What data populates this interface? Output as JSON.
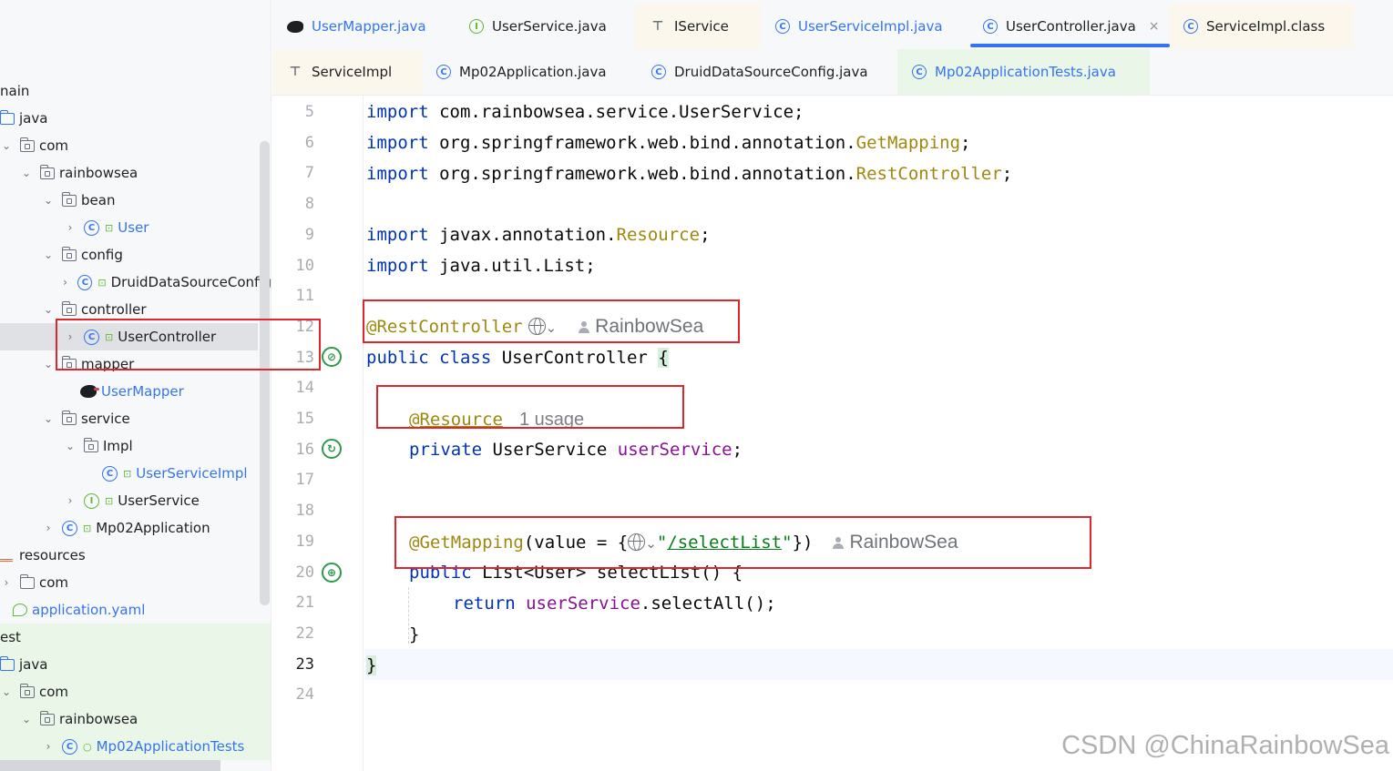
{
  "tree": {
    "items": [
      {
        "label": "nain",
        "icon": "none",
        "chevron": "",
        "blue": false
      },
      {
        "label": "java",
        "icon": "source-folder-icon",
        "chevron": "",
        "blue": false
      },
      {
        "label": "com",
        "icon": "package-folder-icon",
        "chevron": "⌄",
        "blue": false
      },
      {
        "label": "rainbowsea",
        "icon": "package-folder-icon",
        "chevron": "⌄",
        "blue": false
      },
      {
        "label": "bean",
        "icon": "package-folder-icon",
        "chevron": "⌄",
        "blue": false
      },
      {
        "label": "User",
        "icon": "class-icon",
        "chevron": "›",
        "blue": true
      },
      {
        "label": "config",
        "icon": "package-folder-icon",
        "chevron": "⌄",
        "blue": false
      },
      {
        "label": "DruidDataSourceConfig",
        "icon": "class-icon",
        "chevron": "›",
        "blue": false
      },
      {
        "label": "controller",
        "icon": "package-folder-icon",
        "chevron": "⌄",
        "blue": false
      },
      {
        "label": "UserController",
        "icon": "class-icon",
        "chevron": "›",
        "blue": false
      },
      {
        "label": "mapper",
        "icon": "package-folder-icon",
        "chevron": "⌄",
        "blue": false
      },
      {
        "label": "UserMapper",
        "icon": "mybatis-bird-icon",
        "chevron": "",
        "blue": true
      },
      {
        "label": "service",
        "icon": "package-folder-icon",
        "chevron": "⌄",
        "blue": false
      },
      {
        "label": "Impl",
        "icon": "package-folder-icon",
        "chevron": "⌄",
        "blue": false
      },
      {
        "label": "UserServiceImpl",
        "icon": "class-icon",
        "chevron": "",
        "blue": true
      },
      {
        "label": "UserService",
        "icon": "interface-icon",
        "chevron": "›",
        "blue": false
      },
      {
        "label": "Mp02Application",
        "icon": "spring-class-icon",
        "chevron": "›",
        "blue": false
      },
      {
        "label": "resources",
        "icon": "resources-folder-icon",
        "chevron": "",
        "blue": false
      },
      {
        "label": "com",
        "icon": "folder-icon",
        "chevron": "›",
        "blue": false
      },
      {
        "label": "application.yaml",
        "icon": "yaml-file-icon",
        "chevron": "",
        "blue": true
      },
      {
        "label": "est",
        "icon": "none",
        "chevron": "",
        "blue": false
      },
      {
        "label": "java",
        "icon": "test-source-folder-icon",
        "chevron": "",
        "blue": false
      },
      {
        "label": "com",
        "icon": "package-folder-icon",
        "chevron": "⌄",
        "blue": false
      },
      {
        "label": "rainbowsea",
        "icon": "package-folder-icon",
        "chevron": "⌄",
        "blue": false
      },
      {
        "label": "Mp02ApplicationTests",
        "icon": "test-class-icon",
        "chevron": "›",
        "blue": true
      }
    ]
  },
  "tabs": {
    "row1": [
      {
        "label": "UserMapper.java",
        "icon": "mybatis-bird-icon"
      },
      {
        "label": "UserService.java",
        "icon": "interface-icon"
      },
      {
        "label": "IService",
        "icon": "hierarchy-icon"
      },
      {
        "label": "UserServiceImpl.java",
        "icon": "class-icon"
      },
      {
        "label": "UserController.java",
        "icon": "class-icon",
        "active": true,
        "close": "×"
      },
      {
        "label": "ServiceImpl.class",
        "icon": "class-icon"
      }
    ],
    "row2": [
      {
        "label": "ServiceImpl",
        "icon": "hierarchy-icon"
      },
      {
        "label": "Mp02Application.java",
        "icon": "spring-class-icon"
      },
      {
        "label": "DruidDataSourceConfig.java",
        "icon": "class-icon"
      },
      {
        "label": "Mp02ApplicationTests.java",
        "icon": "test-class-icon"
      }
    ]
  },
  "editor": {
    "line_numbers": [
      "5",
      "6",
      "7",
      "8",
      "9",
      "10",
      "11",
      "12",
      "13",
      "14",
      "15",
      "16",
      "17",
      "18",
      "19",
      "20",
      "21",
      "22",
      "23",
      "24"
    ],
    "current_line": "23",
    "code": {
      "l5_kw": "import",
      "l5_rest": " com.rainbowsea.service.UserService;",
      "l6_kw": "import",
      "l6_rest": " org.springframework.web.bind.annotation.",
      "l6_ann": "GetMapping",
      "l6_end": ";",
      "l7_kw": "import",
      "l7_rest": " org.springframework.web.bind.annotation.",
      "l7_ann": "RestController",
      "l7_end": ";",
      "l9_kw": "import",
      "l9_rest": " javax.annotation.",
      "l9_ann": "Resource",
      "l9_end": ";",
      "l10_kw": "import",
      "l10_rest": " java.util.List;",
      "l12_ann": "@RestController",
      "l13_kw": "public class",
      "l13_rest": " UserController ",
      "l13_brace": "{",
      "l15_ann": "@Resource",
      "l16_kw": "private",
      "l16_type": " UserService ",
      "l16_field": "userService",
      "l16_end": ";",
      "l19_ann": "@GetMapping",
      "l19_a": "(value = {",
      "l19_str_open": "\"",
      "l19_str": "/selectList",
      "l19_str_close": "\"",
      "l19_b": "})",
      "l20_kw": "public",
      "l20_rest": " List<User> selectList() {",
      "l21_kw": "return",
      "l21_field": " userService",
      "l21_rest": ".selectAll();",
      "l22": "}",
      "l23": "}"
    },
    "hints": {
      "author": "RainbowSea",
      "usage": "1 usage",
      "chevron": "⌄"
    }
  },
  "watermark": "CSDN @ChinaRainbowSea",
  "colors": {
    "keyword": "#0033b3",
    "annotation": "#9e880d",
    "string": "#067d17",
    "field": "#871094",
    "accent": "#3574f0",
    "annotation_box": "#e0262c"
  }
}
